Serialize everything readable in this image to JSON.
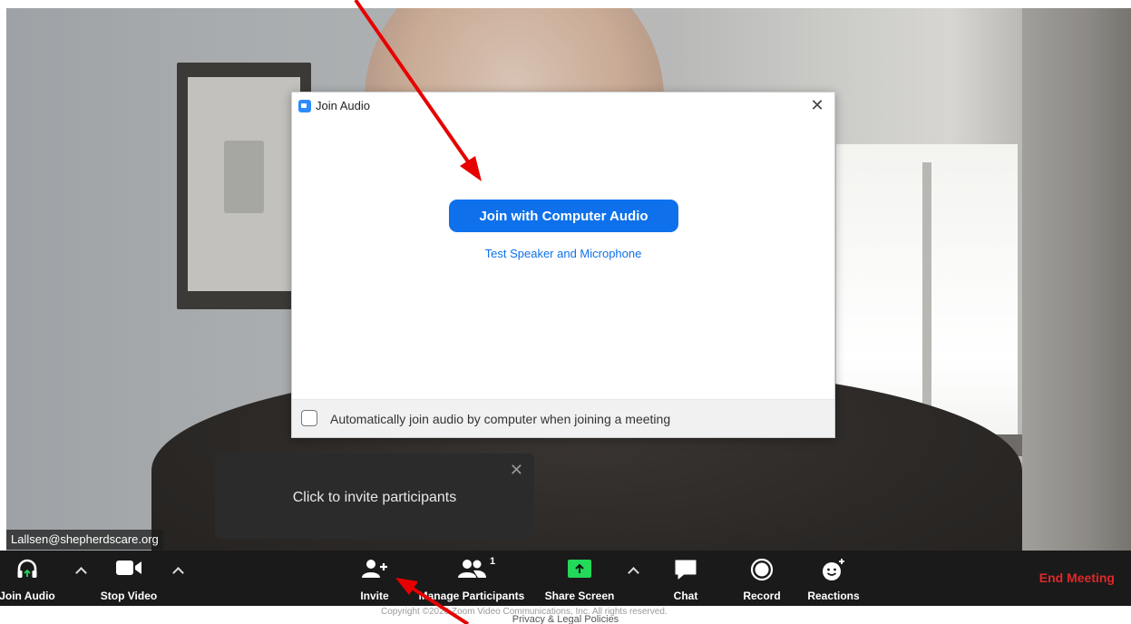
{
  "dialog": {
    "title": "Join Audio",
    "close_glyph": "✕",
    "join_button": "Join with Computer Audio",
    "test_link": "Test Speaker and Microphone",
    "auto_join_label": "Automatically join audio by computer when joining a meeting",
    "auto_join_checked": false
  },
  "tooltip": {
    "text": "Click to invite participants",
    "close_glyph": "✕"
  },
  "video": {
    "participant_name": "Lallsen@shepherdscare.org"
  },
  "toolbar": {
    "join_audio": "Join Audio",
    "stop_video": "Stop Video",
    "invite": "Invite",
    "manage_participants": "Manage Participants",
    "participant_count": "1",
    "share_screen": "Share Screen",
    "chat": "Chat",
    "record": "Record",
    "reactions": "Reactions",
    "end_meeting": "End Meeting"
  },
  "footer": {
    "copyright": "Copyright ©2020 Zoom Video Communications, Inc. All rights reserved.",
    "privacy": "Privacy & Legal Policies"
  },
  "colors": {
    "accent_blue": "#0e71eb",
    "end_meeting_red": "#e02828",
    "share_green": "#23d959",
    "annotation_red": "#e60000",
    "toolbar_bg": "#1a1a1a"
  },
  "icons": [
    "headphones-icon",
    "camera-icon",
    "add-person-icon",
    "participants-icon",
    "share-screen-icon",
    "chat-icon",
    "record-icon",
    "reaction-icon",
    "caret-up-icon",
    "close-icon",
    "zoom-logo-icon",
    "annotation-arrow"
  ]
}
